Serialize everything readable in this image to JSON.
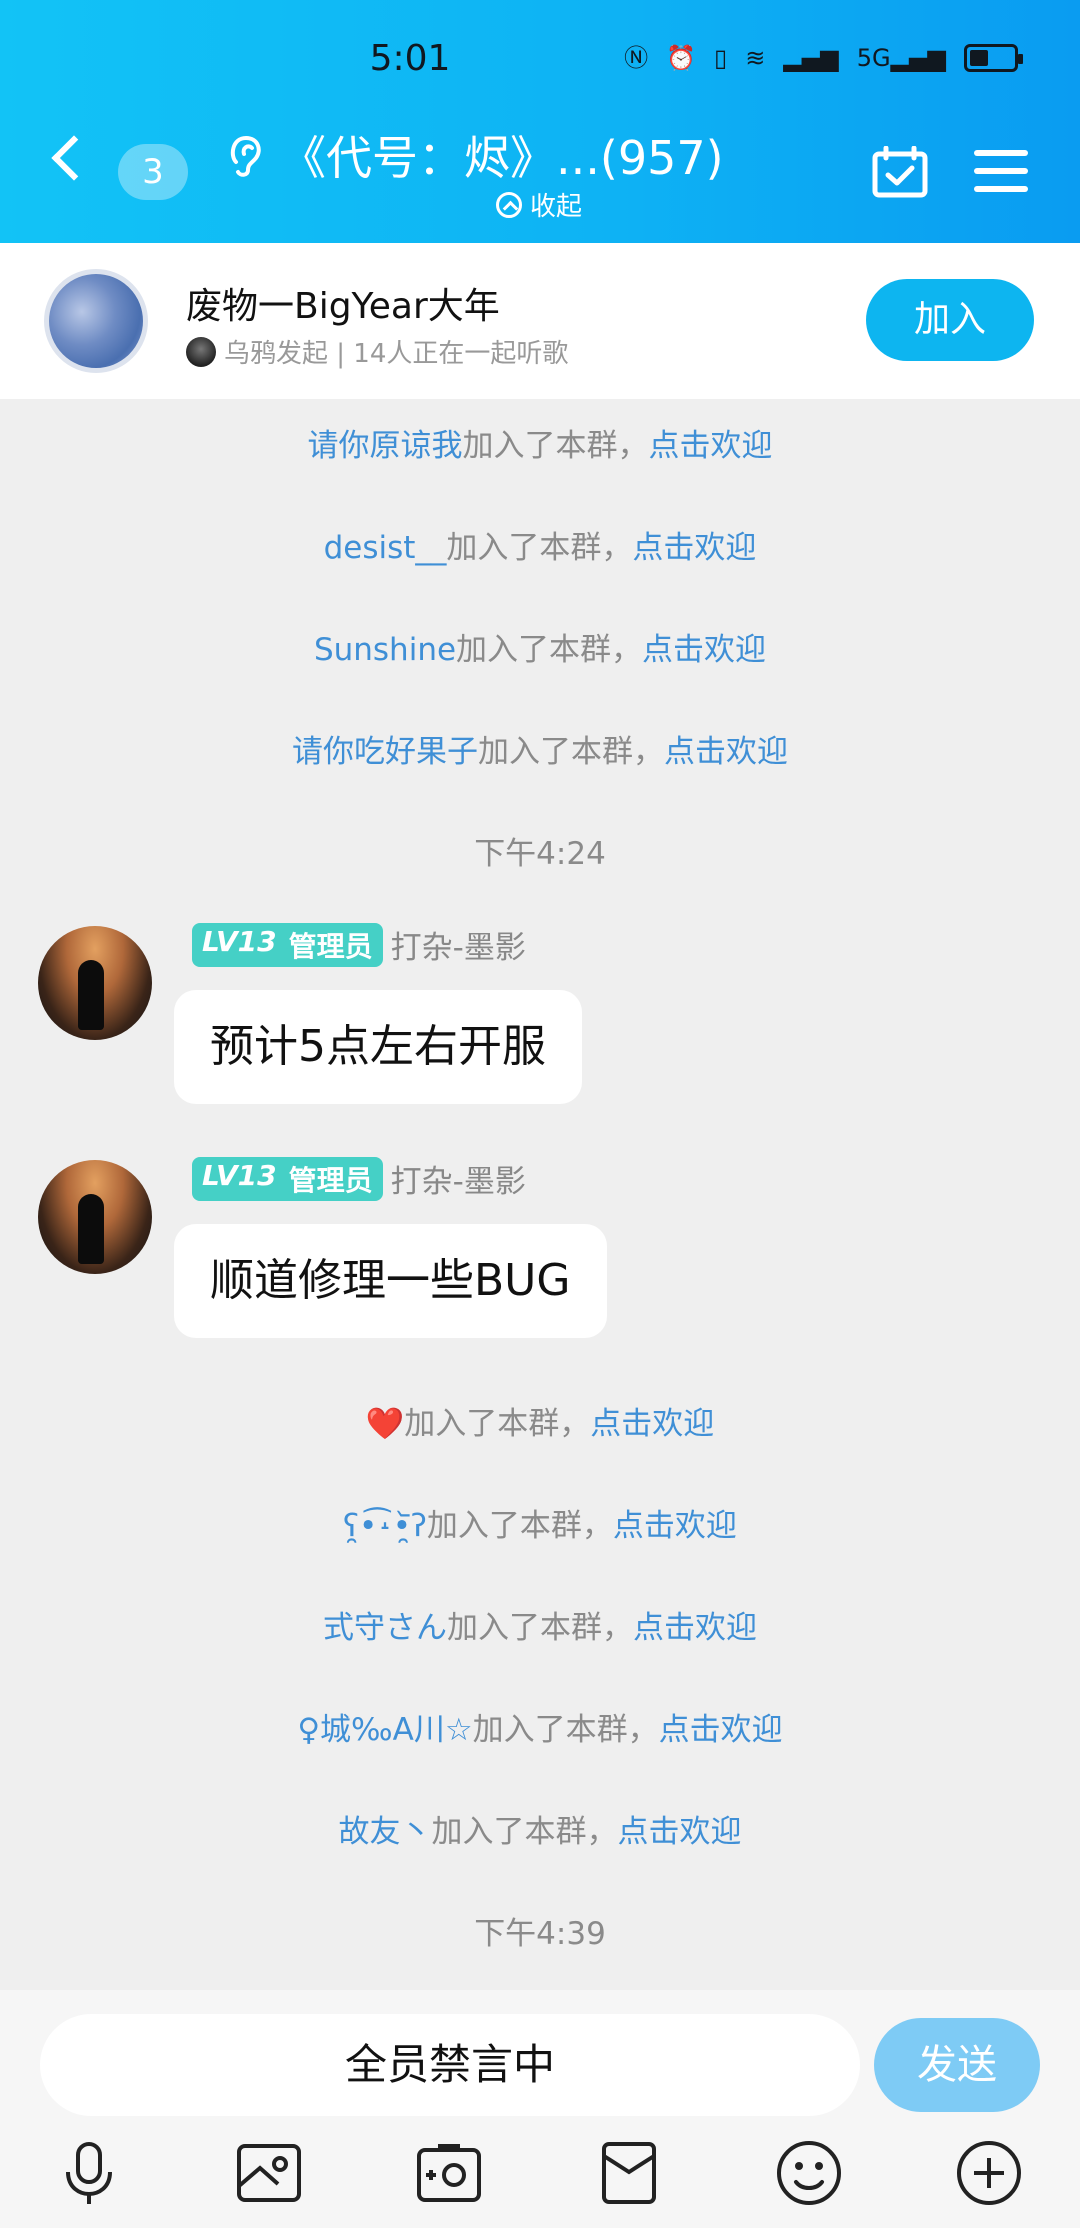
{
  "status_bar": {
    "time": "5:01",
    "icons": [
      "N",
      "⏰",
      "📳",
      "wifi",
      "signal",
      "5G",
      "signal"
    ]
  },
  "header": {
    "unread_count": "3",
    "title": "《代号：烬》...(957)",
    "collapse_label": "收起"
  },
  "listen_together": {
    "song_title": "废物一BigYear大年",
    "subtitle": "乌鸦发起 | 14人正在一起听歌",
    "join_label": "加入"
  },
  "system_messages_top": [
    {
      "name": "请你原谅我",
      "text": "加入了本群，",
      "action": "点击欢迎"
    },
    {
      "name": "desist__",
      "text": "加入了本群，",
      "action": "点击欢迎"
    },
    {
      "name": "Sunshine",
      "text": "加入了本群，",
      "action": "点击欢迎"
    },
    {
      "name": "请你吃好果子",
      "text": "加入了本群，",
      "action": "点击欢迎"
    }
  ],
  "time_1": "下午4:24",
  "messages": [
    {
      "level": "LV13",
      "role": "管理员",
      "sender": "打杂-墨影",
      "text": "预计5点左右开服"
    },
    {
      "level": "LV13",
      "role": "管理员",
      "sender": "打杂-墨影",
      "text": "顺道修理一些BUG"
    }
  ],
  "system_messages_bottom": [
    {
      "name": "❤️",
      "text": "加入了本群，",
      "action": "点击欢迎"
    },
    {
      "name": "ʕ̯•͡˔•̯᷅ʔ",
      "text": "加入了本群，",
      "action": "点击欢迎"
    },
    {
      "name": "式守さん",
      "text": "加入了本群，",
      "action": "点击欢迎"
    },
    {
      "name": "♀城‰A川☆",
      "text": "加入了本群，",
      "action": "点击欢迎"
    },
    {
      "name": "故友丶",
      "text": "加入了本群，",
      "action": "点击欢迎"
    }
  ],
  "time_2": "下午4:39",
  "input": {
    "placeholder": "全员禁言中",
    "send_label": "发送"
  },
  "toolbar_icons": [
    "microphone-icon",
    "image-icon",
    "camera-icon",
    "red-packet-icon",
    "emoji-icon",
    "plus-icon"
  ]
}
